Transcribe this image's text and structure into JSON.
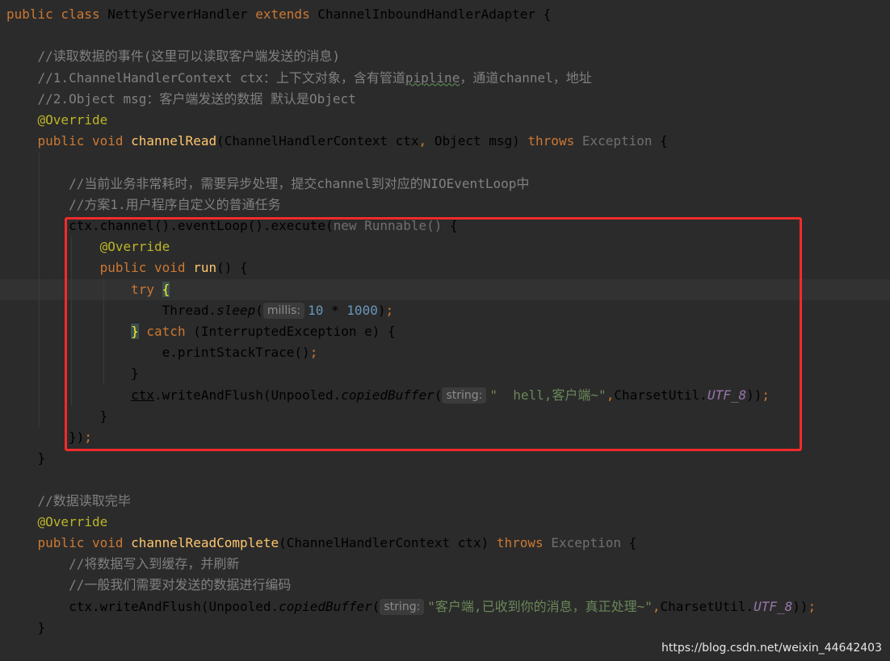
{
  "editor": {
    "lines": [
      {
        "segments": [
          {
            "t": "public class ",
            "c": "kw"
          },
          {
            "t": "NettyServerHandler "
          },
          {
            "t": "extends ",
            "c": "kw"
          },
          {
            "t": "ChannelInboundHandlerAdapter {"
          }
        ]
      },
      {
        "segments": []
      },
      {
        "segments": [
          {
            "t": "    //读取数据的事件(这里可以读取客户端发送的消息)",
            "c": "cm"
          }
        ]
      },
      {
        "segments": [
          {
            "t": "    //1.ChannelHandlerContext ctx：上下文对象，含有管道",
            "c": "cm"
          },
          {
            "t": "pipline",
            "c": "cm wv"
          },
          {
            "t": "，通道channel，地址",
            "c": "cm"
          }
        ]
      },
      {
        "segments": [
          {
            "t": "    //2.Object msg：客户端发送的数据 默认是Object",
            "c": "cm"
          }
        ]
      },
      {
        "segments": [
          {
            "t": "    "
          },
          {
            "t": "@Override",
            "c": "an"
          }
        ]
      },
      {
        "segments": [
          {
            "t": "    "
          },
          {
            "t": "public void ",
            "c": "kw"
          },
          {
            "t": "channelRead",
            "c": "fn"
          },
          {
            "t": "(ChannelHandlerContext ctx"
          },
          {
            "t": ", ",
            "c": "kw"
          },
          {
            "t": "Object msg) "
          },
          {
            "t": "throws ",
            "c": "kw"
          },
          {
            "t": "Exception",
            "c": "gr"
          },
          {
            "t": " {"
          }
        ]
      },
      {
        "segments": []
      },
      {
        "segments": [
          {
            "t": "        //当前业务非常耗时，需要异步处理，提交channel到对应的NIOEventLoop中",
            "c": "cm"
          }
        ]
      },
      {
        "segments": [
          {
            "t": "        //方案1.用户程序自定义的普通任务",
            "c": "cm"
          }
        ]
      },
      {
        "segments": [
          {
            "t": "        ctx.channel().eventLoop().execute("
          },
          {
            "t": "new ",
            "c": "gr"
          },
          {
            "t": "Runnable() ",
            "c": "gr"
          },
          {
            "t": "{"
          }
        ]
      },
      {
        "segments": [
          {
            "t": "            "
          },
          {
            "t": "@Override",
            "c": "an"
          }
        ]
      },
      {
        "segments": [
          {
            "t": "            "
          },
          {
            "t": "public void ",
            "c": "kw"
          },
          {
            "t": "run",
            "c": "fn"
          },
          {
            "t": "() {"
          }
        ]
      },
      {
        "caret": true,
        "segments": [
          {
            "t": "                "
          },
          {
            "t": "try ",
            "c": "kw"
          },
          {
            "t": "{",
            "c": "bh"
          }
        ]
      },
      {
        "segments": [
          {
            "t": "                    Thread."
          },
          {
            "t": "sleep",
            "c": "it"
          },
          {
            "t": "("
          },
          {
            "hint": "millis:"
          },
          {
            "t": "10 ",
            "c": "nm"
          },
          {
            "t": "* "
          },
          {
            "t": "1000",
            "c": "nm"
          },
          {
            "t": ")"
          },
          {
            "t": ";",
            "c": "kw"
          }
        ]
      },
      {
        "segments": [
          {
            "t": "                "
          },
          {
            "t": "}",
            "c": "bh"
          },
          {
            "t": " "
          },
          {
            "t": "catch ",
            "c": "kw"
          },
          {
            "t": "(InterruptedException e) {"
          }
        ]
      },
      {
        "segments": [
          {
            "t": "                    e.printStackTrace()"
          },
          {
            "t": ";",
            "c": "kw"
          }
        ]
      },
      {
        "segments": [
          {
            "t": "                }"
          }
        ]
      },
      {
        "segments": [
          {
            "t": "                "
          },
          {
            "t": "ctx",
            "c": "ul"
          },
          {
            "t": ".writeAndFlush(Unpooled."
          },
          {
            "t": "copiedBuffer",
            "c": "it"
          },
          {
            "t": "("
          },
          {
            "hint": "string:"
          },
          {
            "t": "\"  hell,客户端~\"",
            "c": "st"
          },
          {
            "t": ",",
            "c": "kw"
          },
          {
            "t": "CharsetUtil."
          },
          {
            "t": "UTF_8",
            "c": "cn"
          },
          {
            "t": "))"
          },
          {
            "t": ";",
            "c": "kw"
          }
        ]
      },
      {
        "segments": [
          {
            "t": "            }"
          }
        ]
      },
      {
        "segments": [
          {
            "t": "        })"
          },
          {
            "t": ";",
            "c": "kw"
          }
        ]
      },
      {
        "segments": [
          {
            "t": "    }"
          }
        ]
      },
      {
        "segments": []
      },
      {
        "segments": [
          {
            "t": "    //数据读取完毕",
            "c": "cm"
          }
        ]
      },
      {
        "segments": [
          {
            "t": "    "
          },
          {
            "t": "@Override",
            "c": "an"
          }
        ]
      },
      {
        "segments": [
          {
            "t": "    "
          },
          {
            "t": "public void ",
            "c": "kw"
          },
          {
            "t": "channelReadComplete",
            "c": "fn"
          },
          {
            "t": "(ChannelHandlerContext ctx) "
          },
          {
            "t": "throws ",
            "c": "kw"
          },
          {
            "t": "Exception",
            "c": "gr"
          },
          {
            "t": " {"
          }
        ]
      },
      {
        "segments": [
          {
            "t": "        //将数据写入到缓存，并刷新",
            "c": "cm"
          }
        ]
      },
      {
        "segments": [
          {
            "t": "        //一般我们需要对发送的数据进行编码",
            "c": "cm"
          }
        ]
      },
      {
        "segments": [
          {
            "t": "        ctx.writeAndFlush(Unpooled."
          },
          {
            "t": "copiedBuffer",
            "c": "it"
          },
          {
            "t": "("
          },
          {
            "hint": "string:"
          },
          {
            "t": "\"客户端,已收到你的消息，真正处理~\"",
            "c": "st"
          },
          {
            "t": ",",
            "c": "kw"
          },
          {
            "t": "CharsetUtil."
          },
          {
            "t": "UTF_8",
            "c": "cn"
          },
          {
            "t": "))"
          },
          {
            "t": ";",
            "c": "kw"
          }
        ]
      },
      {
        "segments": [
          {
            "t": "    }"
          }
        ]
      }
    ]
  },
  "watermark": "https://blog.csdn.net/weixin_44642403"
}
